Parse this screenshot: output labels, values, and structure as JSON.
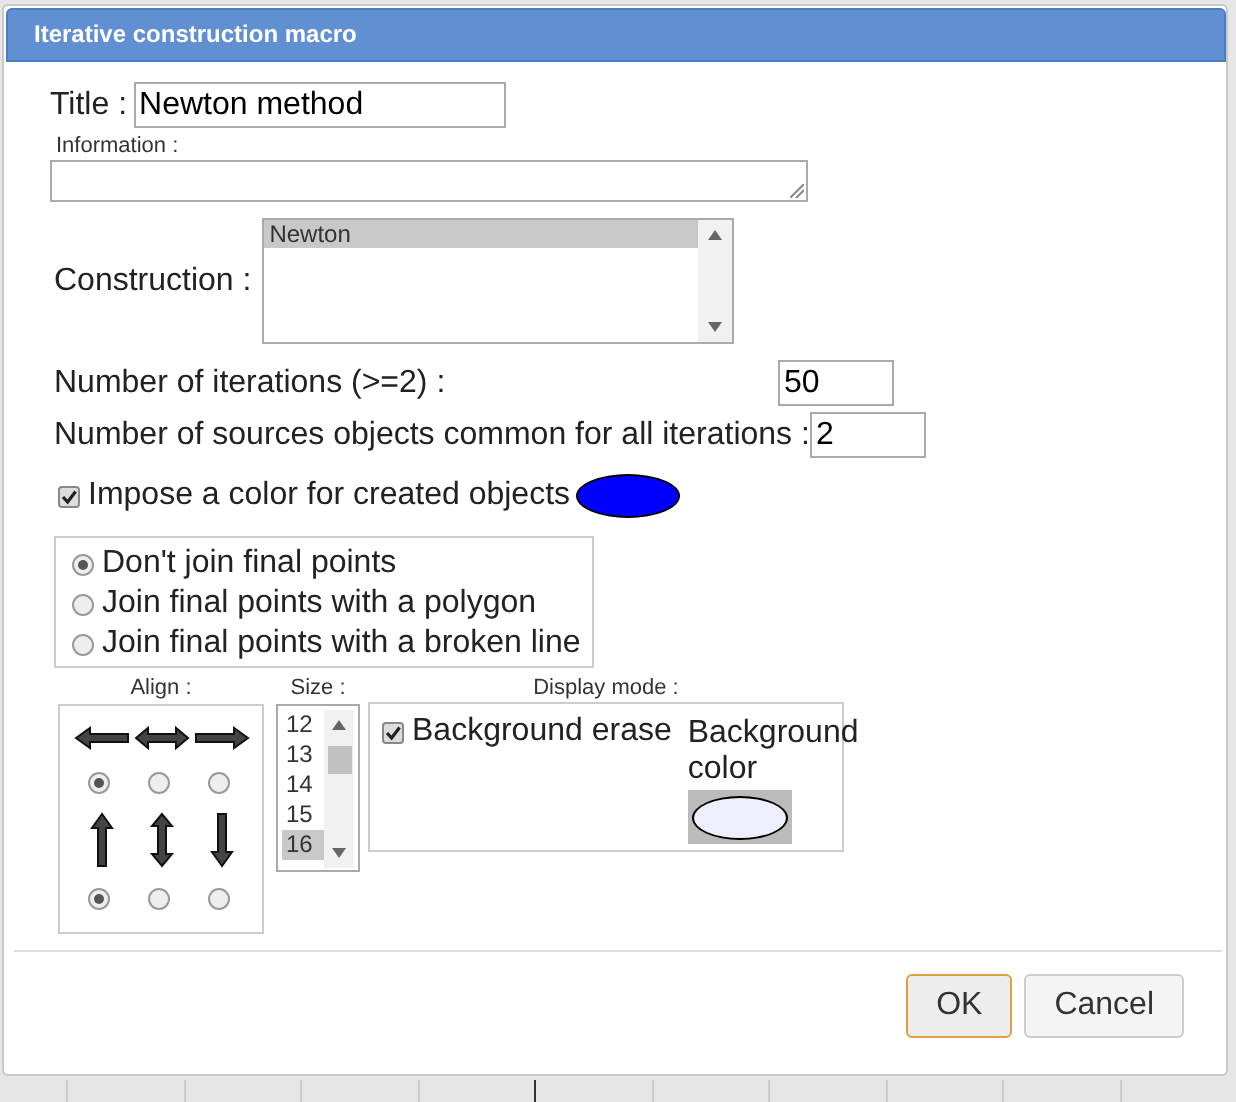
{
  "dialog": {
    "title": "Iterative construction macro"
  },
  "title_field": {
    "label": "Title :",
    "value": "Newton method"
  },
  "information": {
    "label": "Information :"
  },
  "construction": {
    "label": "Construction :",
    "items": [
      {
        "text": "Newton",
        "selected": true
      }
    ]
  },
  "iterations": {
    "label": "Number of iterations (>=2) :",
    "value": "50"
  },
  "sources": {
    "label": "Number of sources objects common for all iterations :",
    "value": "2"
  },
  "impose_color": {
    "label": "Impose a color for created objects",
    "checked": true,
    "color": "#0000ff"
  },
  "join_options": [
    {
      "label": "Don't join final points",
      "selected": true
    },
    {
      "label": "Join final points with a polygon",
      "selected": false
    },
    {
      "label": "Join final points with a broken line",
      "selected": false
    }
  ],
  "align": {
    "label": "Align :",
    "horizontal": [
      {
        "kind": "left",
        "selected": true
      },
      {
        "kind": "both",
        "selected": false
      },
      {
        "kind": "right",
        "selected": false
      }
    ],
    "vertical": [
      {
        "kind": "up",
        "selected": true
      },
      {
        "kind": "both",
        "selected": false
      },
      {
        "kind": "down",
        "selected": false
      }
    ]
  },
  "size": {
    "label": "Size :",
    "items": [
      {
        "text": "12",
        "selected": false
      },
      {
        "text": "13",
        "selected": false
      },
      {
        "text": "14",
        "selected": false
      },
      {
        "text": "15",
        "selected": false
      },
      {
        "text": "16",
        "selected": true
      }
    ]
  },
  "display_mode": {
    "label": "Display mode :",
    "background_erase": {
      "label": "Background erase",
      "checked": true
    },
    "background_color": {
      "label": "Background color",
      "color": "#eeeeff"
    }
  },
  "buttons": [
    {
      "label": "OK",
      "focused": true
    },
    {
      "label": "Cancel",
      "focused": false
    }
  ]
}
